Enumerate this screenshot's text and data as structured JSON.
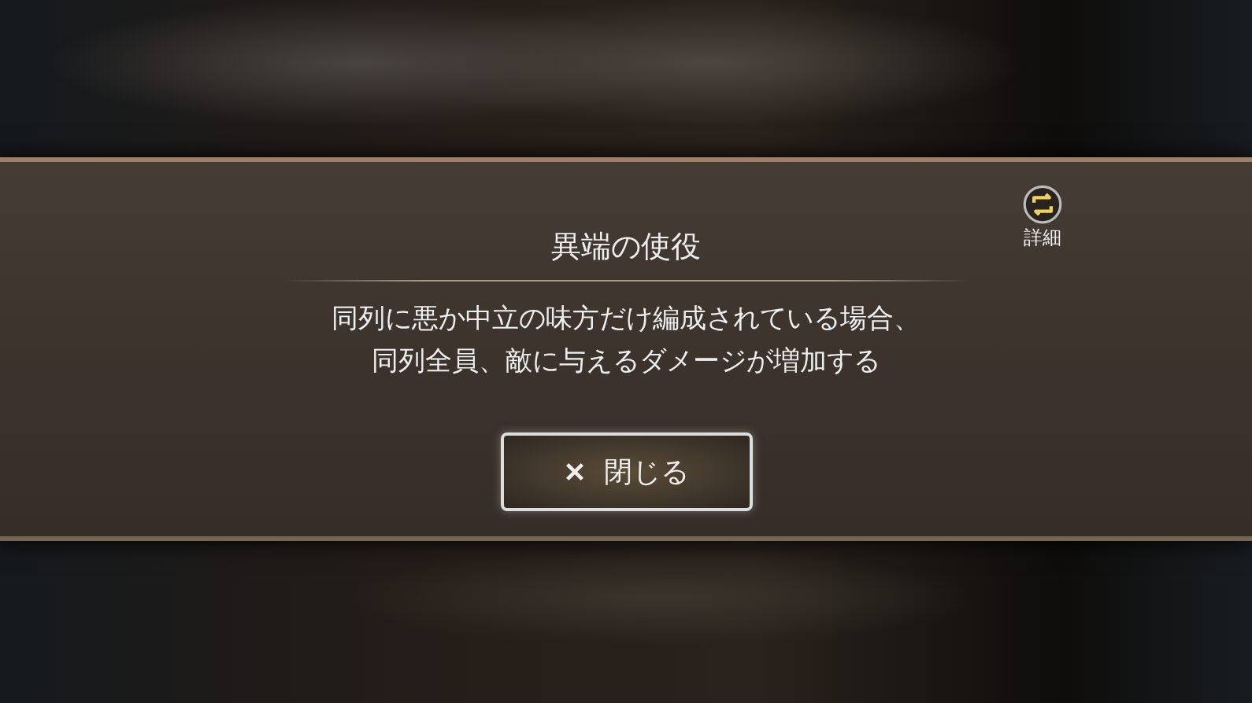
{
  "dialog": {
    "title": "異端の使役",
    "detail_button": {
      "label": "詳細"
    },
    "description_lines": [
      "同列に悪か中立の味方だけ編成されている場合、",
      "同列全員、敵に与えるダメージが増加する"
    ],
    "close_button": {
      "label": "閉じる"
    }
  }
}
